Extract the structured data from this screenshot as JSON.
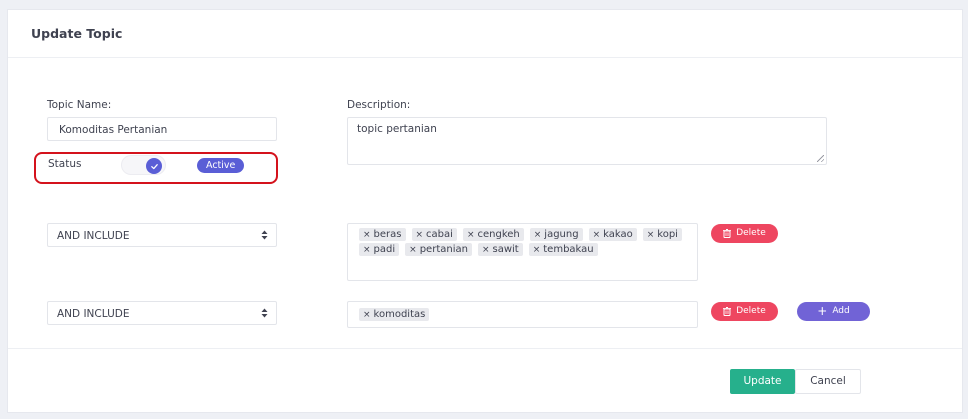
{
  "card": {
    "title": "Update Topic"
  },
  "form": {
    "topic_name_label": "Topic Name:",
    "topic_name_value": "Komoditas Pertanian",
    "description_label": "Description:",
    "description_value": "topic pertanian",
    "status_label": "Status",
    "status_badge": "Active",
    "status_on": true
  },
  "rules": [
    {
      "operator": "AND INCLUDE",
      "keywords": [
        "beras",
        "cabai",
        "cengkeh",
        "jagung",
        "kakao",
        "kopi",
        "padi",
        "pertanian",
        "sawit",
        "tembakau"
      ],
      "delete_label": "Delete"
    },
    {
      "operator": "AND INCLUDE",
      "keywords": [
        "komoditas"
      ],
      "delete_label": "Delete",
      "add_label": "Add"
    }
  ],
  "icons": {
    "tag_remove": "×",
    "check": "✓",
    "add": "+",
    "trash": "trash-icon",
    "select_arrows": "sort-arrows-icon"
  },
  "footer": {
    "update_label": "Update",
    "cancel_label": "Cancel"
  },
  "colors": {
    "primary": "#5a5ed6",
    "danger": "#ee4660",
    "add": "#7163d6",
    "success": "#26b08c",
    "highlight": "#d4121c"
  }
}
